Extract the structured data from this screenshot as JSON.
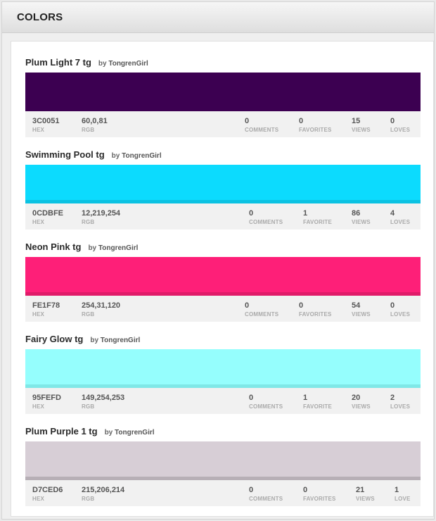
{
  "header": {
    "title": "COLORS"
  },
  "colors": [
    {
      "title": "Plum Light 7 tg",
      "by": "by",
      "author": "TongrenGirl",
      "swatch": "#3c0051",
      "edge": "#3c0051",
      "hex": "3C0051",
      "hex_label": "HEX",
      "rgb": "60,0,81",
      "rgb_label": "RGB",
      "comments": "0",
      "comments_label": "COMMENTS",
      "favorites": "0",
      "favorites_label": "FAVORITES",
      "views": "15",
      "views_label": "VIEWS",
      "loves": "0",
      "loves_label": "LOVES"
    },
    {
      "title": "Swimming Pool tg",
      "by": "by",
      "author": "TongrenGirl",
      "swatch": "#0cdbfe",
      "edge": "#0bc2e2",
      "hex": "0CDBFE",
      "hex_label": "HEX",
      "rgb": "12,219,254",
      "rgb_label": "RGB",
      "comments": "0",
      "comments_label": "COMMENTS",
      "favorites": "1",
      "favorites_label": "FAVORITE",
      "views": "86",
      "views_label": "VIEWS",
      "loves": "4",
      "loves_label": "LOVES"
    },
    {
      "title": "Neon Pink tg",
      "by": "by",
      "author": "TongrenGirl",
      "swatch": "#fe1f78",
      "edge": "#e01b69",
      "hex": "FE1F78",
      "hex_label": "HEX",
      "rgb": "254,31,120",
      "rgb_label": "RGB",
      "comments": "0",
      "comments_label": "COMMENTS",
      "favorites": "0",
      "favorites_label": "FAVORITES",
      "views": "54",
      "views_label": "VIEWS",
      "loves": "0",
      "loves_label": "LOVES"
    },
    {
      "title": "Fairy Glow tg",
      "by": "by",
      "author": "TongrenGirl",
      "swatch": "#95fefd",
      "edge": "#7fe8e7",
      "hex": "95FEFD",
      "hex_label": "HEX",
      "rgb": "149,254,253",
      "rgb_label": "RGB",
      "comments": "0",
      "comments_label": "COMMENTS",
      "favorites": "1",
      "favorites_label": "FAVORITE",
      "views": "20",
      "views_label": "VIEWS",
      "loves": "2",
      "loves_label": "LOVES"
    },
    {
      "title": "Plum Purple 1 tg",
      "by": "by",
      "author": "TongrenGirl",
      "swatch": "#d7ced6",
      "edge": "#b7afb6",
      "hex": "D7CED6",
      "hex_label": "HEX",
      "rgb": "215,206,214",
      "rgb_label": "RGB",
      "comments": "0",
      "comments_label": "COMMENTS",
      "favorites": "0",
      "favorites_label": "FAVORITES",
      "views": "21",
      "views_label": "VIEWS",
      "loves": "1",
      "loves_label": "LOVE"
    }
  ]
}
